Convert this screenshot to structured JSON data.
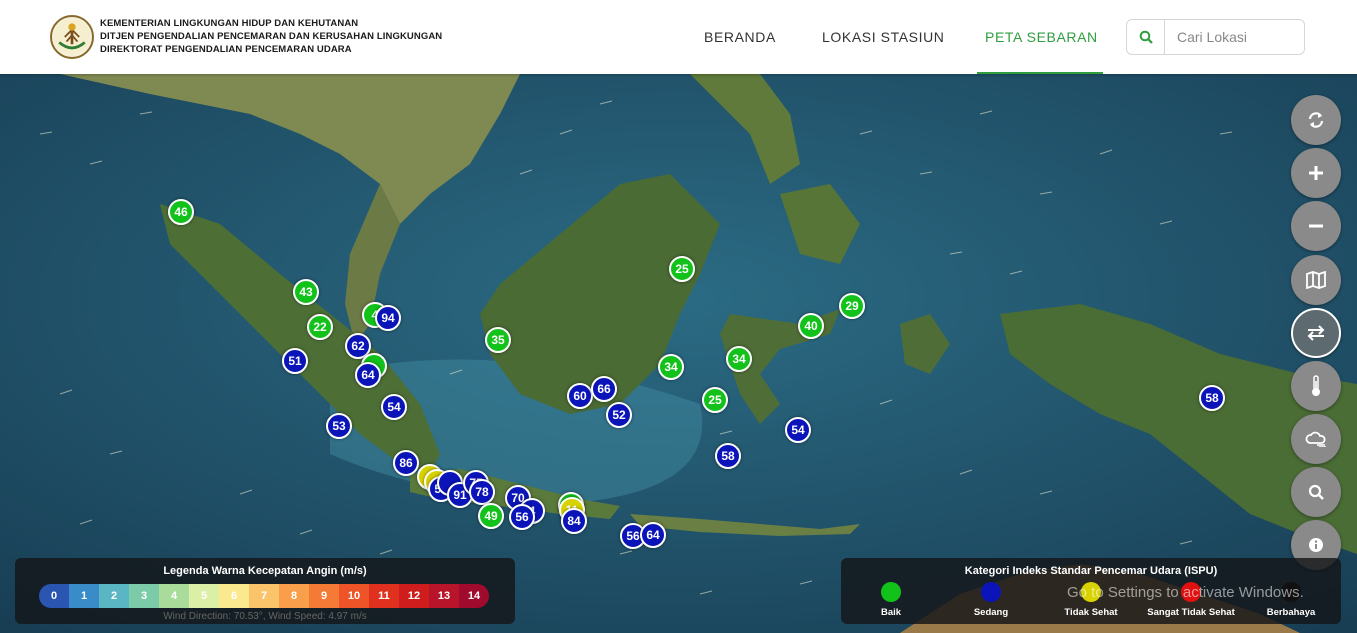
{
  "header": {
    "org_lines": [
      "KEMENTERIAN LINGKUNGAN HIDUP DAN KEHUTANAN",
      "DITJEN PENGENDALIAN PENCEMARAN DAN KERUSAHAN LINGKUNGAN",
      "DIREKTORAT PENGENDALIAN PENCEMARAN UDARA"
    ],
    "nav": [
      {
        "label": "BERANDA",
        "active": false
      },
      {
        "label": "LOKASI STASIUN",
        "active": false
      },
      {
        "label": "PETA SEBARAN",
        "active": true
      }
    ],
    "search_placeholder": "Cari Lokasi"
  },
  "colors": {
    "accent_green": "#2e9e3f",
    "baik": "#12c21a",
    "sedang": "#0a14b8",
    "tidak_sehat": "#d7d200",
    "sangat_tidak_sehat": "#e01010",
    "berbahaya": "#111111"
  },
  "markers": [
    {
      "value": "46",
      "category": "baik"
    },
    {
      "value": "43",
      "category": "baik"
    },
    {
      "value": "22",
      "category": "baik"
    },
    {
      "value": "4",
      "category": "baik"
    },
    {
      "value": "94",
      "category": "sedang"
    },
    {
      "value": "51",
      "category": "sedang"
    },
    {
      "value": "62",
      "category": "sedang"
    },
    {
      "value": "",
      "category": "baik"
    },
    {
      "value": "64",
      "category": "sedang"
    },
    {
      "value": "54",
      "category": "sedang"
    },
    {
      "value": "53",
      "category": "sedang"
    },
    {
      "value": "86",
      "category": "sedang"
    },
    {
      "value": "",
      "category": "tidak-sehat"
    },
    {
      "value": "",
      "category": "tidak-sehat"
    },
    {
      "value": "55",
      "category": "sedang"
    },
    {
      "value": "",
      "category": "sedang"
    },
    {
      "value": "91",
      "category": "sedang"
    },
    {
      "value": "75",
      "category": "sedang"
    },
    {
      "value": "78",
      "category": "sedang"
    },
    {
      "value": "49",
      "category": "baik"
    },
    {
      "value": "70",
      "category": "sedang"
    },
    {
      "value": "4",
      "category": "sedang"
    },
    {
      "value": "56",
      "category": "sedang"
    },
    {
      "value": "",
      "category": "baik"
    },
    {
      "value": "11",
      "category": "tidak-sehat"
    },
    {
      "value": "84",
      "category": "sedang"
    },
    {
      "value": "56",
      "category": "sedang"
    },
    {
      "value": "64",
      "category": "sedang"
    },
    {
      "value": "35",
      "category": "baik"
    },
    {
      "value": "25",
      "category": "baik"
    },
    {
      "value": "60",
      "category": "sedang"
    },
    {
      "value": "66",
      "category": "sedang"
    },
    {
      "value": "52",
      "category": "sedang"
    },
    {
      "value": "34",
      "category": "baik"
    },
    {
      "value": "34",
      "category": "baik"
    },
    {
      "value": "25",
      "category": "baik"
    },
    {
      "value": "40",
      "category": "baik"
    },
    {
      "value": "29",
      "category": "baik"
    },
    {
      "value": "58",
      "category": "sedang"
    },
    {
      "value": "54",
      "category": "sedang"
    },
    {
      "value": "58",
      "category": "sedang"
    }
  ],
  "controls": [
    {
      "name": "refresh-button",
      "icon": "refresh-icon"
    },
    {
      "name": "zoom-in-button",
      "icon": "plus-icon"
    },
    {
      "name": "zoom-out-button",
      "icon": "minus-icon"
    },
    {
      "name": "map-layer-button",
      "icon": "map-icon"
    },
    {
      "name": "wind-toggle-button",
      "icon": "swap-arrows-icon",
      "active": true
    },
    {
      "name": "temperature-button",
      "icon": "thermometer-icon"
    },
    {
      "name": "cloud-wind-button",
      "icon": "cloud-wind-icon"
    },
    {
      "name": "search-map-button",
      "icon": "search-icon"
    },
    {
      "name": "info-button",
      "icon": "info-icon"
    }
  ],
  "wind_legend": {
    "title": "Legenda Warna Kecepatan Angin (m/s)",
    "scale": [
      {
        "label": "0",
        "color": "#2a55b0"
      },
      {
        "label": "1",
        "color": "#3a8cc9"
      },
      {
        "label": "2",
        "color": "#5bb6c4"
      },
      {
        "label": "3",
        "color": "#7ccba8"
      },
      {
        "label": "4",
        "color": "#a9dc9b"
      },
      {
        "label": "5",
        "color": "#dcefa6"
      },
      {
        "label": "6",
        "color": "#fbe98f"
      },
      {
        "label": "7",
        "color": "#fbc46a"
      },
      {
        "label": "8",
        "color": "#f99f4c"
      },
      {
        "label": "9",
        "color": "#f47a35"
      },
      {
        "label": "10",
        "color": "#ee5428"
      },
      {
        "label": "11",
        "color": "#e0301e"
      },
      {
        "label": "12",
        "color": "#cf1d1d"
      },
      {
        "label": "13",
        "color": "#b8142a"
      },
      {
        "label": "14",
        "color": "#a00a2d"
      }
    ],
    "info": "Wind Direction: 70.53°, Wind Speed: 4.97 m/s"
  },
  "ispu_legend": {
    "title": "Kategori Indeks Standar Pencemar Udara (ISPU)",
    "items": [
      {
        "label": "Baik",
        "color": "#12c21a"
      },
      {
        "label": "Sedang",
        "color": "#0a14b8"
      },
      {
        "label": "Tidak Sehat",
        "color": "#d7d200"
      },
      {
        "label": "Sangat Tidak Sehat",
        "color": "#e01010"
      },
      {
        "label": "Berbahaya",
        "color": "#111111"
      }
    ]
  },
  "watermark": "Go to Settings to activate Windows."
}
